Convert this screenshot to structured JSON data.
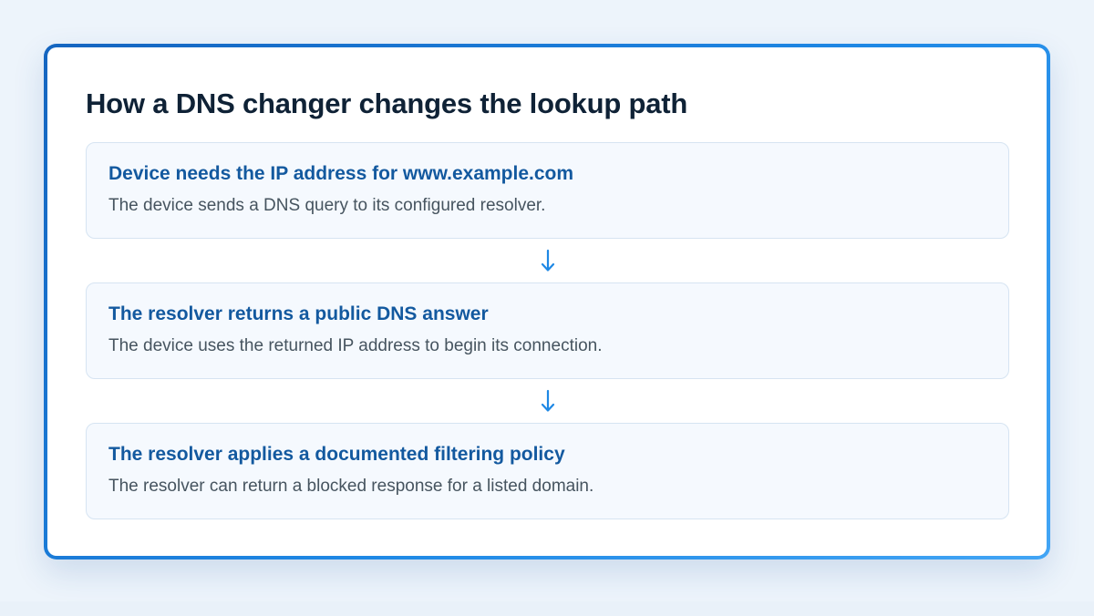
{
  "title": "How a DNS changer changes the lookup path",
  "steps": [
    {
      "title": "Device needs the IP address for www.example.com",
      "description": "The device sends a DNS query to its configured resolver."
    },
    {
      "title": "The resolver returns a public DNS answer",
      "description": "The device uses the returned IP address to begin its connection."
    },
    {
      "title": "The resolver applies a documented filtering policy",
      "description": "The resolver can return a blocked response for a listed domain."
    }
  ],
  "arrow_icon": "arrow-down-icon",
  "colors": {
    "accent": "#1e88e5",
    "card_border_start": "#1565c0",
    "card_border_end": "#42a5f5",
    "step_title": "#13599f",
    "heading": "#0f2236",
    "body_text": "#46545f",
    "step_background": "#f5f9fe",
    "step_border": "#d6e4f2"
  }
}
